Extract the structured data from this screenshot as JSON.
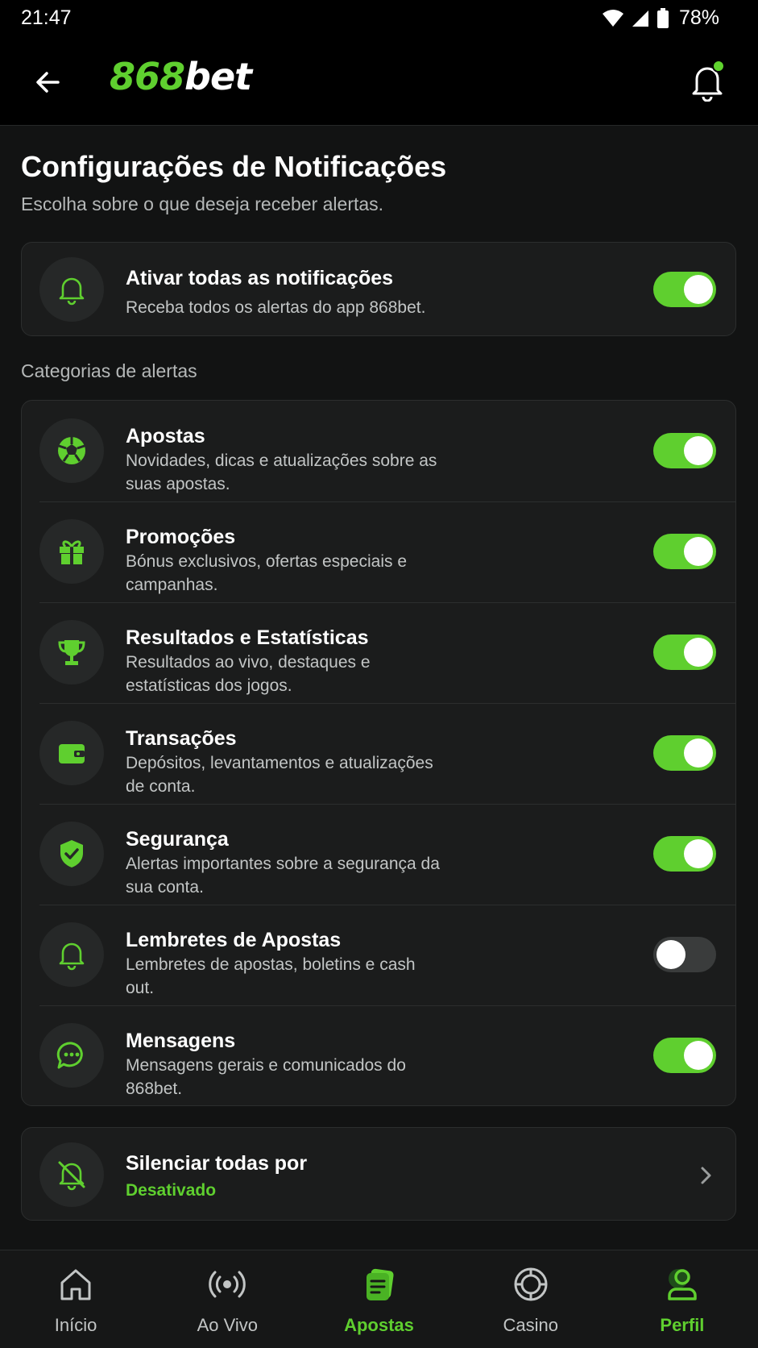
{
  "status": {
    "time": "21:47",
    "battery": "78%"
  },
  "brand": {
    "logo_prefix": "868",
    "logo_suffix": "bet",
    "accent": "#5fcf2f"
  },
  "page": {
    "title": "Configurações de Notificações",
    "subtitle": "Escolha sobre o que deseja receber alertas."
  },
  "master": {
    "title": "Ativar todas as notificações",
    "desc": "Receba todos os alertas do app 868bet.",
    "icon": "bell-icon",
    "enabled": true
  },
  "categories": {
    "label": "Categorias de alertas",
    "items": [
      {
        "title": "Apostas",
        "desc": "Novidades, dicas e atualizações sobre as suas apostas.",
        "icon": "soccer-ball-icon",
        "enabled": true
      },
      {
        "title": "Promoções",
        "desc": "Bónus exclusivos, ofertas especiais e campanhas.",
        "icon": "gift-icon",
        "enabled": true
      },
      {
        "title": "Resultados e Estatísticas",
        "desc": "Resultados ao vivo, destaques e estatísticas dos jogos.",
        "icon": "trophy-icon",
        "enabled": true
      },
      {
        "title": "Transações",
        "desc": "Depósitos, levantamentos e atualizações de conta.",
        "icon": "wallet-icon",
        "enabled": true
      },
      {
        "title": "Segurança",
        "desc": "Alertas importantes sobre a segurança da sua conta.",
        "icon": "shield-check-icon",
        "enabled": true
      },
      {
        "title": "Lembretes de Apostas",
        "desc": "Lembretes de apostas, boletins e cash out.",
        "icon": "bell-icon",
        "enabled": false
      },
      {
        "title": "Mensagens",
        "desc": "Mensagens gerais e comunicados do 868bet.",
        "icon": "chat-icon",
        "enabled": true
      }
    ]
  },
  "mute": {
    "title": "Silenciar todas por",
    "value": "Desativado",
    "icon": "bell-off-icon"
  },
  "nav": {
    "items": [
      {
        "label": "Início",
        "icon": "home-icon",
        "active": false
      },
      {
        "label": "Ao Vivo",
        "icon": "live-icon",
        "active": false
      },
      {
        "label": "Apostas",
        "icon": "bet-slip-icon",
        "active": true
      },
      {
        "label": "Casino",
        "icon": "casino-chip-icon",
        "active": false
      },
      {
        "label": "Perfil",
        "icon": "user-icon",
        "active": true
      }
    ]
  }
}
